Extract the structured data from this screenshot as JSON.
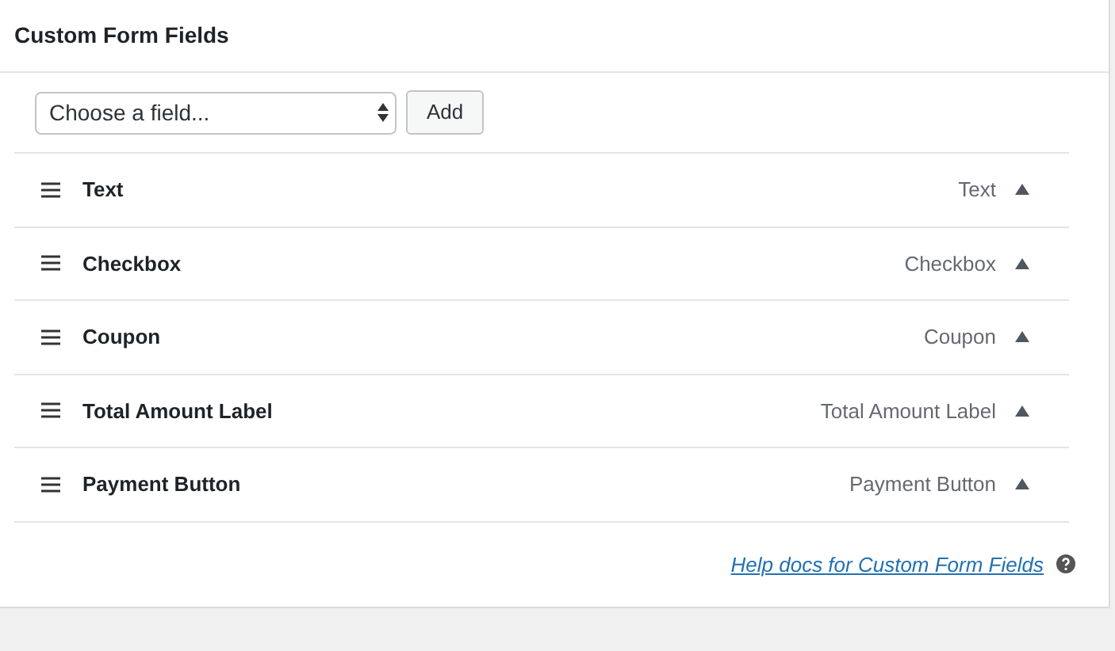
{
  "panel": {
    "title": "Custom Form Fields"
  },
  "field_picker": {
    "value": "Choose a field...",
    "button": "Add"
  },
  "fields": [
    {
      "label": "Text",
      "type": "Text"
    },
    {
      "label": "Checkbox",
      "type": "Checkbox"
    },
    {
      "label": "Coupon",
      "type": "Coupon"
    },
    {
      "label": "Total Amount Label",
      "type": "Total Amount Label"
    },
    {
      "label": "Payment Button",
      "type": "Payment Button"
    }
  ],
  "help_link": "Help docs for Custom Form Fields"
}
